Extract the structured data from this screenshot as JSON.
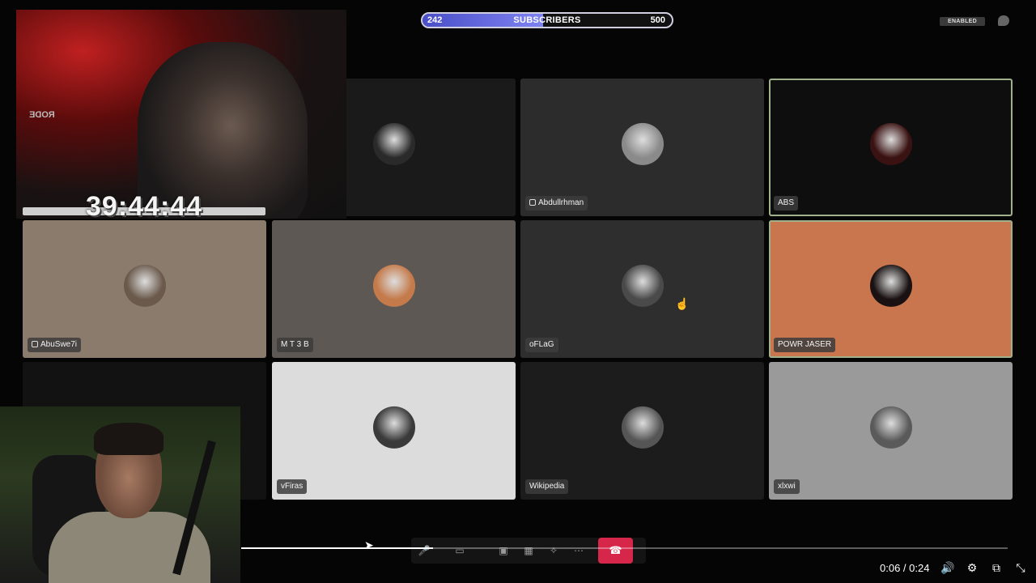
{
  "subscribers": {
    "current": "242",
    "label": "SUBSCRIBERS",
    "goal": "500",
    "progress": 0.484
  },
  "status_badge": "ENABLED",
  "timer": "39:44:44",
  "webcam_mic_label": "RODE",
  "participants": [
    {
      "name": "",
      "bg": "#1a1a1a",
      "avatar_bg": "#2a2a2a"
    },
    {
      "name": "Abdullrhman",
      "bg": "#2c2c2c",
      "avatar_bg": "#8a8a8a",
      "mic": true
    },
    {
      "name": "ABS",
      "bg": "#0e0e0e",
      "avatar_bg": "#3a1212"
    },
    {
      "name": "AbuSwe7i",
      "bg": "#8a7b6d",
      "avatar_bg": "#6b5a4c",
      "mic": true
    },
    {
      "name": "M T 3 B",
      "bg": "#5e5854",
      "avatar_bg": "#c47a4a"
    },
    {
      "name": "oFLaG",
      "bg": "#2e2e2e",
      "avatar_bg": "#4a4a4a"
    },
    {
      "name": "POWR JASER",
      "bg": "#c9754e",
      "avatar_bg": "#1a1212"
    },
    {
      "name": "",
      "bg": "#121212",
      "avatar_bg": "#121212"
    },
    {
      "name": "vFiras",
      "bg": "#dcdcdc",
      "avatar_bg": "#3a3a3a"
    },
    {
      "name": "Wikipedia",
      "bg": "#1c1c1c",
      "avatar_bg": "#555"
    },
    {
      "name": "xlxwi",
      "bg": "#9a9a9a",
      "avatar_bg": "#5a5a5a"
    }
  ],
  "player": {
    "time": "0:06 / 0:24",
    "progress": 0.25
  },
  "colors": {
    "end_call": "#d6264a",
    "subscriber_fill": "#4a4fc8"
  }
}
